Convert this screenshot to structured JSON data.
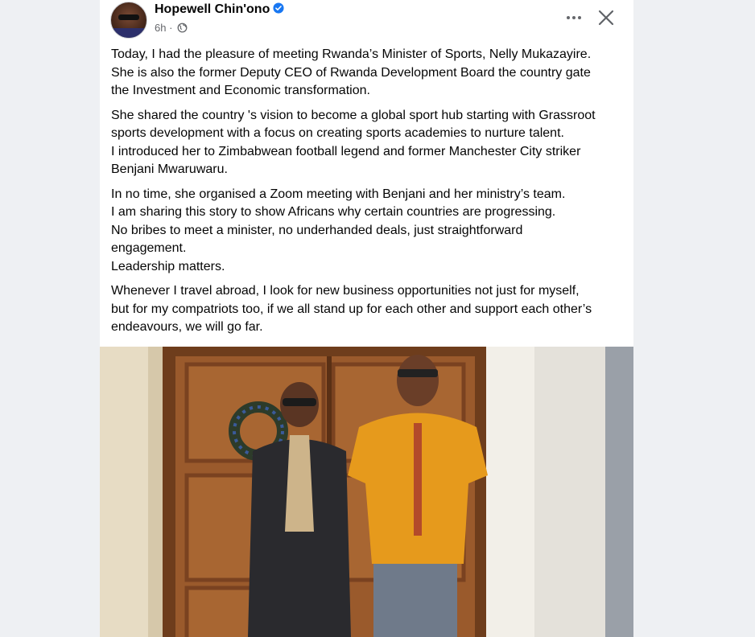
{
  "post": {
    "author": "Hopewell Chin'ono",
    "time": "6h",
    "visibility_icon": "globe-icon",
    "verified_icon": "verified-badge-icon",
    "more_icon": "more-options-icon",
    "close_icon": "close-icon",
    "paragraphs": [
      [
        "Today, I had the pleasure of meeting Rwanda’s Minister of Sports, Nelly Mukazayire.",
        "She is also the former Deputy CEO of Rwanda Development Board the country gate",
        "the Investment and Economic transformation."
      ],
      [
        "She shared the country 's vision to become a global sport hub starting with Grassroot",
        "sports development with a focus  on creating sports academies to nurture talent.",
        "I introduced her to Zimbabwean football legend and former Manchester City striker",
        "Benjani Mwaruwaru."
      ],
      [
        "In no time, she organised a Zoom meeting with Benjani and her ministry’s team.",
        "I am sharing this story to show Africans why certain countries are progressing.",
        "No bribes to meet a minister, no underhanded deals, just straightforward",
        "engagement.",
        "Leadership matters."
      ],
      [
        "Whenever I travel abroad, I look for new business opportunities not just for myself,",
        "but for my compatriots too, if we all stand up for each other and support each other’s",
        "endeavours, we will go far."
      ]
    ]
  },
  "colors": {
    "page_bg": "#eef0f3",
    "card_bg": "#ffffff",
    "text": "#050505",
    "secondary_text": "#65676b",
    "verified_blue": "#1877f2",
    "door_wood": "#9a5a2c",
    "orange_shirt": "#e69a1c",
    "black_suit": "#2a2a2e"
  }
}
